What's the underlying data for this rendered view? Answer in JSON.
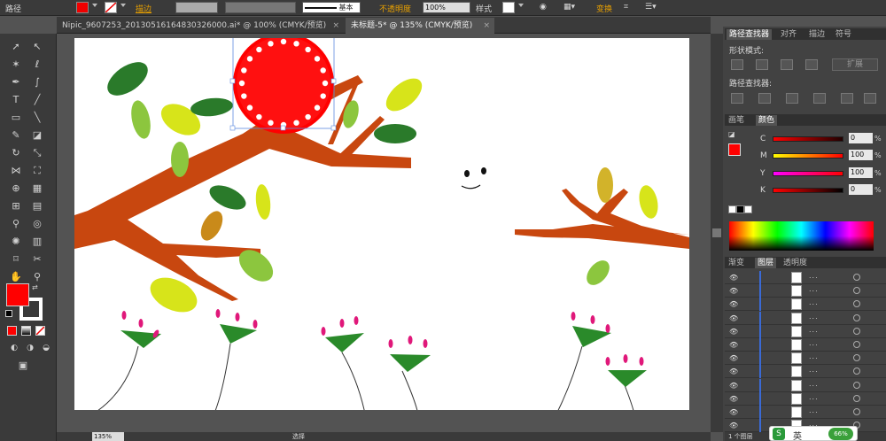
{
  "control_bar": {
    "tool_name": "路径",
    "fill_color": "#f00000",
    "stroke_label": "描边",
    "stroke_style_label": "基本",
    "opacity_label": "不透明度",
    "opacity_value": "100%",
    "style_label": "样式",
    "transform_label": "变换"
  },
  "tabs": [
    {
      "label": "Nipic_9607253_20130516164830326000.ai* @ 100% (CMYK/预览)",
      "close": "×"
    },
    {
      "label": "未标题-5* @ 135% (CMYK/预览)",
      "close": "×"
    }
  ],
  "tools": {
    "fill_color": "#ff0000",
    "stroke_color": "#ffffff"
  },
  "pathfinder": {
    "tabs": [
      "路径查找器",
      "对齐",
      "描边",
      "符号"
    ],
    "shape_modes_label": "形状模式:",
    "expand_button": "扩展",
    "pathfinders_label": "路径查找器:"
  },
  "color_panel": {
    "tabs": [
      "画笔",
      "颜色"
    ],
    "channels": [
      {
        "name": "C",
        "value": "0",
        "unit": "%"
      },
      {
        "name": "M",
        "value": "100",
        "unit": "%"
      },
      {
        "name": "Y",
        "value": "100",
        "unit": "%"
      },
      {
        "name": "K",
        "value": "0",
        "unit": "%"
      }
    ]
  },
  "layers_panel": {
    "tabs": [
      "渐变",
      "图层",
      "透明度"
    ],
    "row_dots": "...",
    "footer": "1 个图层"
  },
  "zoom": {
    "value": "135%"
  },
  "status": {
    "tool": "选择"
  },
  "ime": {
    "label": "英",
    "badge": "66%"
  }
}
